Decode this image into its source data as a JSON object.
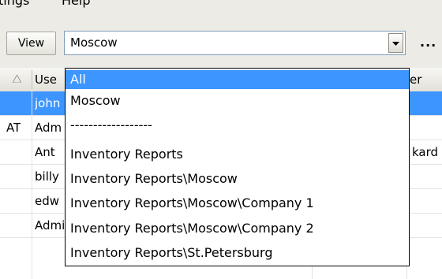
{
  "menubar": {
    "items": [
      {
        "label": "tings"
      },
      {
        "label": "Help"
      }
    ]
  },
  "toolbar": {
    "view_label": "View",
    "combo_value": "Moscow",
    "more_label": "..."
  },
  "grid": {
    "headers": [
      "Use",
      "er"
    ],
    "rows": [
      {
        "prefix": "",
        "user": "john",
        "extra": ""
      },
      {
        "prefix": "AT",
        "user": "Adm",
        "extra": ""
      },
      {
        "prefix": "",
        "user": "Ant",
        "extra": "kard"
      },
      {
        "prefix": "",
        "user": "billy",
        "extra": ""
      },
      {
        "prefix": "",
        "user": "edw",
        "extra": ""
      },
      {
        "prefix": "",
        "user": "Administrator",
        "extra": ""
      }
    ]
  },
  "dropdown": {
    "options": [
      "All",
      "Moscow",
      "------------------",
      "Inventory Reports",
      "Inventory Reports\\Moscow",
      "Inventory Reports\\Moscow\\Company 1",
      "Inventory Reports\\Moscow\\Company 2",
      "Inventory Reports\\St.Petersburg"
    ],
    "highlighted_index": 0
  },
  "colors": {
    "selection": "#3d95ff",
    "toolbar_bg": "#ecebe6"
  }
}
